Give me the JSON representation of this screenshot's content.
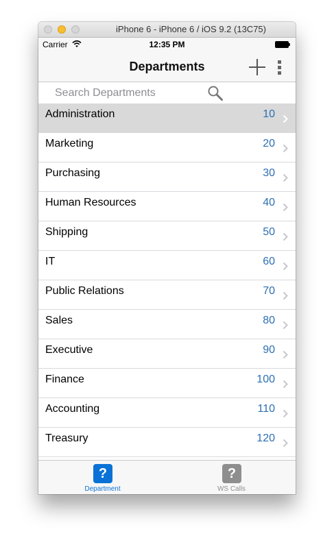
{
  "window": {
    "title": "iPhone 6 - iPhone 6 / iOS 9.2 (13C75)"
  },
  "statusbar": {
    "carrier": "Carrier",
    "time": "12:35 PM"
  },
  "navbar": {
    "title": "Departments",
    "add_icon": "plus-icon",
    "more_icon": "more-vertical-icon"
  },
  "search": {
    "placeholder": "Search Departments",
    "value": "",
    "icon": "search-icon"
  },
  "departments": [
    {
      "name": "Administration",
      "id": "10",
      "selected": true
    },
    {
      "name": "Marketing",
      "id": "20"
    },
    {
      "name": "Purchasing",
      "id": "30"
    },
    {
      "name": "Human Resources",
      "id": "40"
    },
    {
      "name": "Shipping",
      "id": "50"
    },
    {
      "name": "IT",
      "id": "60"
    },
    {
      "name": "Public Relations",
      "id": "70"
    },
    {
      "name": "Sales",
      "id": "80"
    },
    {
      "name": "Executive",
      "id": "90"
    },
    {
      "name": "Finance",
      "id": "100"
    },
    {
      "name": "Accounting",
      "id": "110"
    },
    {
      "name": "Treasury",
      "id": "120"
    }
  ],
  "tabs": [
    {
      "label": "Department",
      "icon": "question-icon",
      "active": true
    },
    {
      "label": "WS Calls",
      "icon": "question-icon",
      "active": false
    }
  ],
  "colors": {
    "accent": "#0a72d6",
    "value_text": "#2c6fb2",
    "inactive_tab": "#8e8e8e",
    "selected_row": "#d9d9d9"
  }
}
